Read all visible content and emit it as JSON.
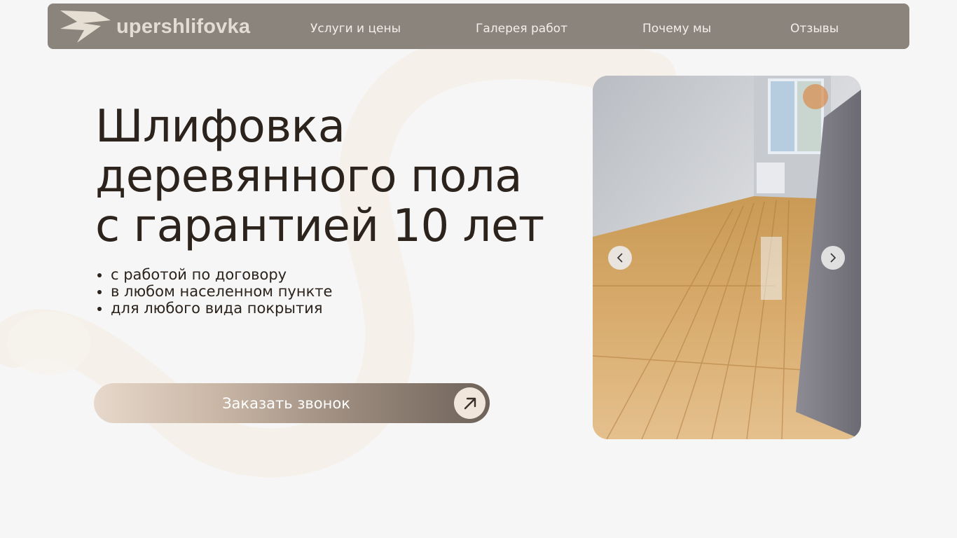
{
  "header": {
    "logo_text": "upershlifovka",
    "logo_icon": "lightning-bolt-icon",
    "nav": [
      {
        "label": "Услуги и цены"
      },
      {
        "label": "Галерея работ"
      },
      {
        "label": "Почему мы"
      },
      {
        "label": "Отзывы"
      }
    ]
  },
  "hero": {
    "title_lines": [
      "Шлифовка",
      "деревянного пола",
      "с гарантией 10 лет"
    ],
    "bullets": [
      "с работой по договору",
      "в любом населенном пункте",
      "для любого вида покрытия"
    ],
    "cta_label": "Заказать звонок",
    "cta_icon": "arrow-up-right-icon"
  },
  "gallery": {
    "prev_icon": "chevron-left-icon",
    "next_icon": "chevron-right-icon"
  },
  "colors": {
    "navbar": "#8a847c",
    "title": "#2b231c",
    "background": "#f7f6f6",
    "cta_start": "#e6d8cb",
    "cta_end": "#6e6259"
  }
}
